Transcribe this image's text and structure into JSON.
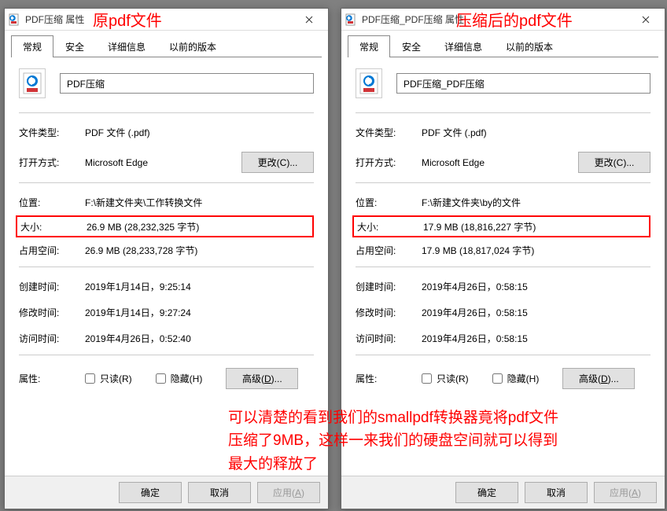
{
  "annotations": {
    "left_title": "原pdf文件",
    "right_title": "压缩后的pdf文件",
    "paragraph": "可以清楚的看到我们的smallpdf转换器竟将pdf文件压缩了9MB，这样一来我们的硬盘空间就可以得到最大的释放了"
  },
  "tabs": {
    "general": "常规",
    "security": "安全",
    "details": "详细信息",
    "previous": "以前的版本"
  },
  "labels": {
    "file_type": "文件类型:",
    "opens_with": "打开方式:",
    "location": "位置:",
    "size": "大小:",
    "size_on_disk": "占用空间:",
    "created": "创建时间:",
    "modified": "修改时间:",
    "accessed": "访问时间:",
    "attributes": "属性:",
    "readonly": "只读(R)",
    "hidden": "隐藏(H)"
  },
  "buttons": {
    "change": "更改(C)...",
    "advanced_prefix": "高级(",
    "advanced_letter": "D",
    "advanced_suffix": ")...",
    "ok": "确定",
    "cancel": "取消",
    "apply_prefix": "应用(",
    "apply_letter": "A",
    "apply_suffix": ")"
  },
  "left": {
    "window_title": "PDF压缩 属性",
    "file_name": "PDF压缩",
    "file_type": "PDF 文件 (.pdf)",
    "opens_with": "Microsoft Edge",
    "location": "F:\\新建文件夹\\工作转换文件",
    "size": "26.9 MB (28,232,325 字节)",
    "size_on_disk": "26.9 MB (28,233,728 字节)",
    "created": "2019年1月14日，9:25:14",
    "modified": "2019年1月14日，9:27:24",
    "accessed": "2019年4月26日，0:52:40"
  },
  "right": {
    "window_title": "PDF压缩_PDF压缩 属性",
    "file_name": "PDF压缩_PDF压缩",
    "file_type": "PDF 文件 (.pdf)",
    "opens_with": "Microsoft Edge",
    "location": "F:\\新建文件夹\\by的文件",
    "size": "17.9 MB (18,816,227 字节)",
    "size_on_disk": "17.9 MB (18,817,024 字节)",
    "created": "2019年4月26日，0:58:15",
    "modified": "2019年4月26日，0:58:15",
    "accessed": "2019年4月26日，0:58:15"
  }
}
